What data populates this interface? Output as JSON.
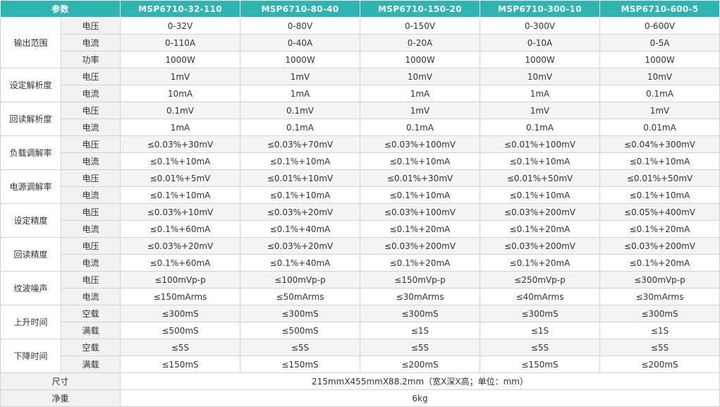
{
  "header": {
    "param_label": "参数",
    "models": [
      "MSP6710-32-110",
      "MSP6710-80-40",
      "MSP6710-150-20",
      "MSP6710-300-10",
      "MSP6710-600-5"
    ]
  },
  "groups": [
    {
      "name": "输出范围",
      "rows": [
        {
          "sub": "电压",
          "values": [
            "0-32V",
            "0-80V",
            "0-150V",
            "0-300V",
            "0-600V"
          ]
        },
        {
          "sub": "电流",
          "values": [
            "0-110A",
            "0-40A",
            "0-20A",
            "0-10A",
            "0-5A"
          ]
        },
        {
          "sub": "功率",
          "values": [
            "1000W",
            "1000W",
            "1000W",
            "1000W",
            "1000W"
          ]
        }
      ]
    },
    {
      "name": "设定解析度",
      "rows": [
        {
          "sub": "电压",
          "values": [
            "1mV",
            "1mV",
            "10mV",
            "10mV",
            "10mV"
          ]
        },
        {
          "sub": "电流",
          "values": [
            "10mA",
            "1mA",
            "1mA",
            "1mA",
            "0.1mA"
          ]
        }
      ]
    },
    {
      "name": "回读解析度",
      "rows": [
        {
          "sub": "电压",
          "values": [
            "0.1mV",
            "0.1mV",
            "1mV",
            "1mV",
            "1mV"
          ]
        },
        {
          "sub": "电流",
          "values": [
            "1mA",
            "0.1mA",
            "0.1mA",
            "0.1mA",
            "0.01mA"
          ]
        }
      ]
    },
    {
      "name": "负载调解率",
      "rows": [
        {
          "sub": "电压",
          "values": [
            "≤0.03%+30mV",
            "≤0.03%+70mV",
            "≤0.03%+100mV",
            "≤0.01%+100mV",
            "≤0.04%+300mV"
          ]
        },
        {
          "sub": "电流",
          "values": [
            "≤0.1%+10mA",
            "≤0.1%+10mA",
            "≤0.1%+10mA",
            "≤0.1%+10mA",
            "≤0.1%+10mA"
          ]
        }
      ]
    },
    {
      "name": "电源调解率",
      "rows": [
        {
          "sub": "电压",
          "values": [
            "≤0.01%+5mV",
            "≤0.01%+10mV",
            "≤0.01%+30mV",
            "≤0.01%+50mV",
            "≤0.01%+50mV"
          ]
        },
        {
          "sub": "电流",
          "values": [
            "≤0.1%+10mA",
            "≤0.1%+10mA",
            "≤0.1%+10mA",
            "≤0.1%+10mA",
            "≤0.1%+10mA"
          ]
        }
      ]
    },
    {
      "name": "设定精度",
      "rows": [
        {
          "sub": "电压",
          "values": [
            "≤0.03%+10mV",
            "≤0.03%+20mV",
            "≤0.03%+100mV",
            "≤0.03%+200mV",
            "≤0.05%+400mV"
          ]
        },
        {
          "sub": "电流",
          "values": [
            "≤0.1%+60mA",
            "≤0.1%+40mA",
            "≤0.1%+20mA",
            "≤0.1%+20mA",
            "≤0.1%+20mA"
          ]
        }
      ]
    },
    {
      "name": "回读精度",
      "rows": [
        {
          "sub": "电压",
          "values": [
            "≤0.03%+20mV",
            "≤0.03%+20mV",
            "≤0.03%+200mV",
            "≤0.03%+200mV",
            "≤0.03%+200mV"
          ]
        },
        {
          "sub": "电流",
          "values": [
            "≤0.1%+60mA",
            "≤0.1%+40mA",
            "≤0.1%+20mA",
            "≤0.1%+20mA",
            "≤0.1%+20mA"
          ]
        }
      ]
    },
    {
      "name": "纹波噪声",
      "rows": [
        {
          "sub": "电压",
          "values": [
            "≤100mVp-p",
            "≤100mVp-p",
            "≤150mVp-p",
            "≤250mVp-p",
            "≤300mVp-p"
          ]
        },
        {
          "sub": "电流",
          "values": [
            "≤150mArms",
            "≤50mArms",
            "≤30mArms",
            "≤40mArms",
            "≤30mArms"
          ]
        }
      ]
    },
    {
      "name": "上升时间",
      "rows": [
        {
          "sub": "空载",
          "values": [
            "≤300mS",
            "≤300mS",
            "≤300mS",
            "≤300mS",
            "≤300mS"
          ]
        },
        {
          "sub": "满载",
          "values": [
            "≤500mS",
            "≤500mS",
            "≤1S",
            "≤1S",
            "≤1S"
          ]
        }
      ]
    },
    {
      "name": "下降时间",
      "rows": [
        {
          "sub": "空载",
          "values": [
            "≤5S",
            "≤5S",
            "≤5S",
            "≤5S",
            "≤5S"
          ]
        },
        {
          "sub": "满载",
          "values": [
            "≤150mS",
            "≤150mS",
            "≤200mS",
            "≤150mS",
            "≤200mS"
          ]
        }
      ]
    }
  ],
  "footer": [
    {
      "label": "尺寸",
      "value": "215mmX455mmX88.2mm（宽X深X高；单位：mm）"
    },
    {
      "label": "净重",
      "value": "6kg"
    }
  ]
}
